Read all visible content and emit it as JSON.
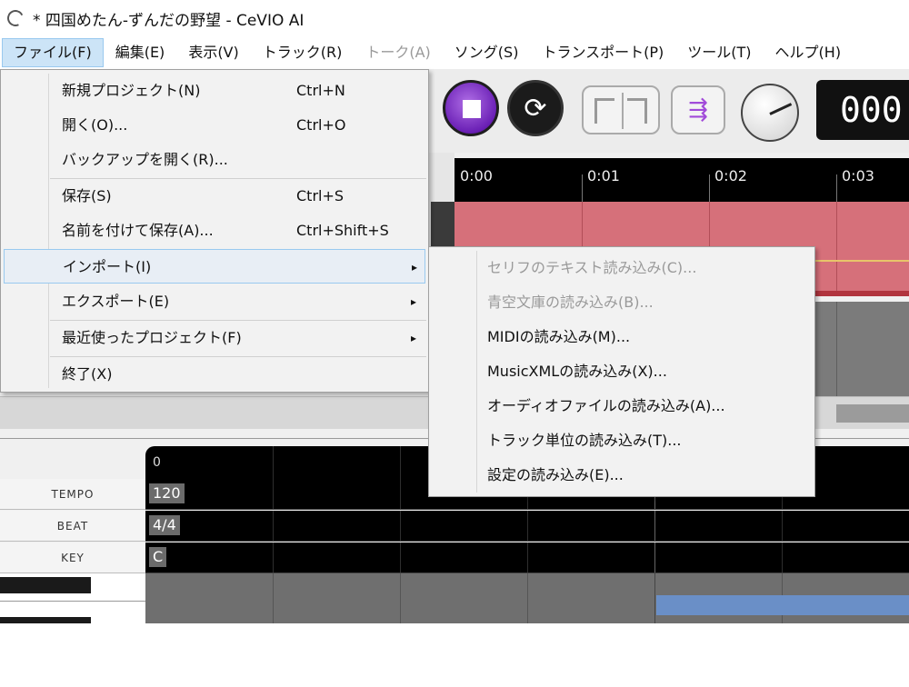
{
  "window": {
    "title": "* 四国めたん-ずんだの野望 - CeVIO AI"
  },
  "menubar": [
    {
      "id": "file",
      "label": "ファイル(F)",
      "active": true
    },
    {
      "id": "edit",
      "label": "編集(E)"
    },
    {
      "id": "view",
      "label": "表示(V)"
    },
    {
      "id": "track",
      "label": "トラック(R)"
    },
    {
      "id": "talk",
      "label": "トーク(A)",
      "disabled": true
    },
    {
      "id": "song",
      "label": "ソング(S)"
    },
    {
      "id": "transport",
      "label": "トランスポート(P)"
    },
    {
      "id": "tools",
      "label": "ツール(T)"
    },
    {
      "id": "help",
      "label": "ヘルプ(H)"
    }
  ],
  "file_menu": {
    "items": [
      {
        "label": "新規プロジェクト(N)",
        "shortcut": "Ctrl+N"
      },
      {
        "label": "開く(O)...",
        "shortcut": "Ctrl+O"
      },
      {
        "label": "バックアップを開く(R)...",
        "shortcut": ""
      },
      {
        "label": "保存(S)",
        "shortcut": "Ctrl+S"
      },
      {
        "label": "名前を付けて保存(A)...",
        "shortcut": "Ctrl+Shift+S"
      },
      {
        "label": "インポート(I)",
        "shortcut": "",
        "submenu": true,
        "highlighted": true
      },
      {
        "label": "エクスポート(E)",
        "shortcut": "",
        "submenu": true
      },
      {
        "label": "最近使ったプロジェクト(F)",
        "shortcut": "",
        "submenu": true
      },
      {
        "label": "終了(X)",
        "shortcut": ""
      }
    ]
  },
  "import_submenu": {
    "items": [
      {
        "label": "セリフのテキスト読み込み(C)...",
        "disabled": true
      },
      {
        "label": "青空文庫の読み込み(B)...",
        "disabled": true
      },
      {
        "label": "MIDIの読み込み(M)..."
      },
      {
        "label": "MusicXMLの読み込み(X)..."
      },
      {
        "label": "オーディオファイルの読み込み(A)..."
      },
      {
        "label": "トラック単位の読み込み(T)..."
      },
      {
        "label": "設定の読み込み(E)..."
      }
    ]
  },
  "timeline": {
    "ticks": [
      "0:00",
      "0:01",
      "0:02",
      "0:03"
    ]
  },
  "transport": {
    "counter": "000"
  },
  "editor": {
    "ruler_start": "0",
    "rows": [
      {
        "label": "TEMPO",
        "value": "120"
      },
      {
        "label": "BEAT",
        "value": "4/4"
      },
      {
        "label": "KEY",
        "value": "C"
      }
    ]
  },
  "icons": {
    "app": "cevio-app-icon",
    "stop": "stop-icon",
    "loop": "loop-icon",
    "submenu_arrow": "▸"
  }
}
